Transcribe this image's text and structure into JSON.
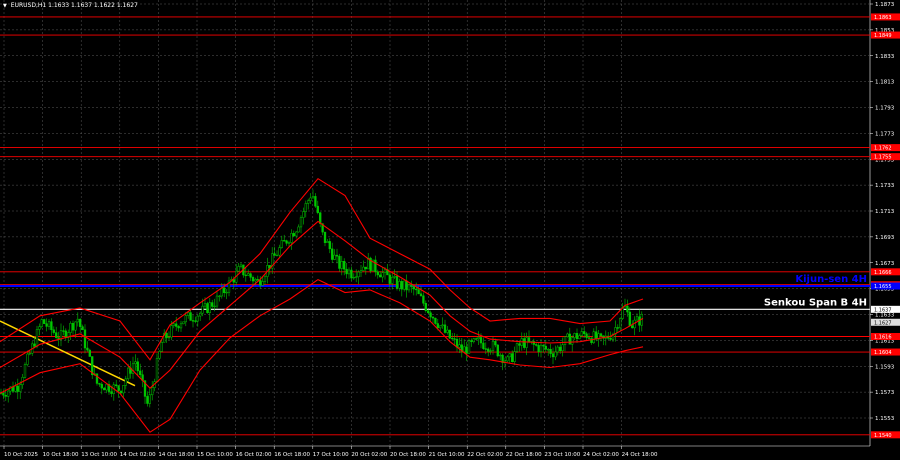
{
  "header": {
    "symbol": "EURUSD,H1",
    "ohlc": "1.1633 1.1637 1.1622 1.1627"
  },
  "colors": {
    "background": "#000000",
    "grid": "#5a5a5a",
    "bull_candle": "#00c800",
    "bear_candle": "#00c800",
    "bollinger": "#ff0000",
    "trend_line": "#ffd700",
    "kijun": "#0000ff",
    "senkou": "#ffffff",
    "level": "#ff0000"
  },
  "chart_data": {
    "type": "candlestick",
    "instrument": "EURUSD",
    "timeframe": "H1",
    "y_range": [
      1.1536,
      1.1873
    ],
    "y_ticks": [
      "1.1873",
      "1.1853",
      "1.1833",
      "1.1813",
      "1.1793",
      "1.1773",
      "1.1753",
      "1.1733",
      "1.1713",
      "1.1693",
      "1.1673",
      "1.1653",
      "1.1633",
      "1.1613",
      "1.1593",
      "1.1573",
      "1.1553"
    ],
    "x_ticks": [
      "10 Oct 2025",
      "10 Oct 18:00",
      "13 Oct 10:00",
      "14 Oct 02:00",
      "14 Oct 18:00",
      "15 Oct 10:00",
      "16 Oct 02:00",
      "16 Oct 18:00",
      "17 Oct 10:00",
      "20 Oct 02:00",
      "20 Oct 18:00",
      "21 Oct 10:00",
      "22 Oct 02:00",
      "22 Oct 18:00",
      "23 Oct 10:00",
      "24 Oct 02:00",
      "24 Oct 18:00"
    ],
    "close_path": [
      [
        0,
        1.1572
      ],
      [
        18,
        1.1578
      ],
      [
        42,
        1.1628
      ],
      [
        60,
        1.1615
      ],
      [
        78,
        1.163
      ],
      [
        96,
        1.158
      ],
      [
        120,
        1.1575
      ],
      [
        135,
        1.1598
      ],
      [
        148,
        1.1562
      ],
      [
        162,
        1.1612
      ],
      [
        180,
        1.1628
      ],
      [
        200,
        1.1634
      ],
      [
        218,
        1.1645
      ],
      [
        240,
        1.1668
      ],
      [
        258,
        1.1658
      ],
      [
        278,
        1.1682
      ],
      [
        296,
        1.17
      ],
      [
        312,
        1.1728
      ],
      [
        322,
        1.1695
      ],
      [
        338,
        1.1672
      ],
      [
        352,
        1.1665
      ],
      [
        368,
        1.1673
      ],
      [
        382,
        1.1665
      ],
      [
        398,
        1.1656
      ],
      [
        414,
        1.1652
      ],
      [
        430,
        1.1635
      ],
      [
        446,
        1.1618
      ],
      [
        462,
        1.1605
      ],
      [
        478,
        1.1612
      ],
      [
        494,
        1.1608
      ],
      [
        508,
        1.1596
      ],
      [
        522,
        1.1612
      ],
      [
        538,
        1.1608
      ],
      [
        554,
        1.1604
      ],
      [
        570,
        1.1615
      ],
      [
        586,
        1.1618
      ],
      [
        602,
        1.1612
      ],
      [
        614,
        1.162
      ],
      [
        624,
        1.164
      ],
      [
        632,
        1.1625
      ],
      [
        642,
        1.163
      ]
    ],
    "bollinger_upper": [
      [
        0,
        1.1612
      ],
      [
        40,
        1.1632
      ],
      [
        80,
        1.1638
      ],
      [
        120,
        1.1628
      ],
      [
        150,
        1.1598
      ],
      [
        170,
        1.1625
      ],
      [
        200,
        1.1642
      ],
      [
        230,
        1.1658
      ],
      [
        260,
        1.168
      ],
      [
        290,
        1.1712
      ],
      [
        318,
        1.1738
      ],
      [
        345,
        1.1725
      ],
      [
        370,
        1.1692
      ],
      [
        400,
        1.168
      ],
      [
        430,
        1.1668
      ],
      [
        450,
        1.1652
      ],
      [
        470,
        1.1638
      ],
      [
        490,
        1.1628
      ],
      [
        520,
        1.163
      ],
      [
        550,
        1.163
      ],
      [
        580,
        1.1626
      ],
      [
        610,
        1.1628
      ],
      [
        625,
        1.164
      ],
      [
        643,
        1.1645
      ]
    ],
    "bollinger_middle": [
      [
        0,
        1.1592
      ],
      [
        40,
        1.161
      ],
      [
        80,
        1.1618
      ],
      [
        120,
        1.16
      ],
      [
        150,
        1.1576
      ],
      [
        170,
        1.159
      ],
      [
        200,
        1.162
      ],
      [
        230,
        1.164
      ],
      [
        260,
        1.166
      ],
      [
        290,
        1.1686
      ],
      [
        318,
        1.1705
      ],
      [
        345,
        1.169
      ],
      [
        370,
        1.1675
      ],
      [
        400,
        1.1662
      ],
      [
        430,
        1.1648
      ],
      [
        450,
        1.1632
      ],
      [
        470,
        1.162
      ],
      [
        490,
        1.1614
      ],
      [
        520,
        1.1612
      ],
      [
        550,
        1.1611
      ],
      [
        580,
        1.1612
      ],
      [
        610,
        1.1616
      ],
      [
        625,
        1.1622
      ],
      [
        643,
        1.163
      ]
    ],
    "bollinger_lower": [
      [
        0,
        1.1572
      ],
      [
        40,
        1.1588
      ],
      [
        80,
        1.1595
      ],
      [
        120,
        1.1572
      ],
      [
        150,
        1.1542
      ],
      [
        170,
        1.1552
      ],
      [
        200,
        1.159
      ],
      [
        230,
        1.1615
      ],
      [
        260,
        1.1632
      ],
      [
        290,
        1.1645
      ],
      [
        318,
        1.166
      ],
      [
        345,
        1.165
      ],
      [
        370,
        1.1652
      ],
      [
        400,
        1.1642
      ],
      [
        430,
        1.1628
      ],
      [
        450,
        1.1612
      ],
      [
        470,
        1.16
      ],
      [
        490,
        1.1598
      ],
      [
        520,
        1.1594
      ],
      [
        550,
        1.1592
      ],
      [
        580,
        1.1595
      ],
      [
        610,
        1.1602
      ],
      [
        625,
        1.1605
      ],
      [
        643,
        1.1608
      ]
    ],
    "trend_line": [
      [
        0,
        1.1628
      ],
      [
        135,
        1.1578
      ]
    ],
    "levels": [
      {
        "price": 1.1863,
        "label": "1.1863"
      },
      {
        "price": 1.1849,
        "label": "1.1849"
      },
      {
        "price": 1.1762,
        "label": "1.1762"
      },
      {
        "price": 1.1755,
        "label": "1.1755"
      },
      {
        "price": 1.1666,
        "label": "1.1666"
      },
      {
        "price": 1.1656,
        "label": "1.1656"
      },
      {
        "price": 1.1616,
        "label": "1.1616"
      },
      {
        "price": 1.1604,
        "label": "1.1604"
      },
      {
        "price": 1.154,
        "label": "1.1540"
      }
    ],
    "kijun": {
      "price": 1.1655,
      "label": "Kijun-sen 4H",
      "tag": "1.1655"
    },
    "senkou": {
      "price": 1.1637,
      "label": "Senkou Span B 4H",
      "tag": "1.1637"
    },
    "current_price": {
      "price": 1.1627,
      "tag": "1.1627"
    }
  }
}
